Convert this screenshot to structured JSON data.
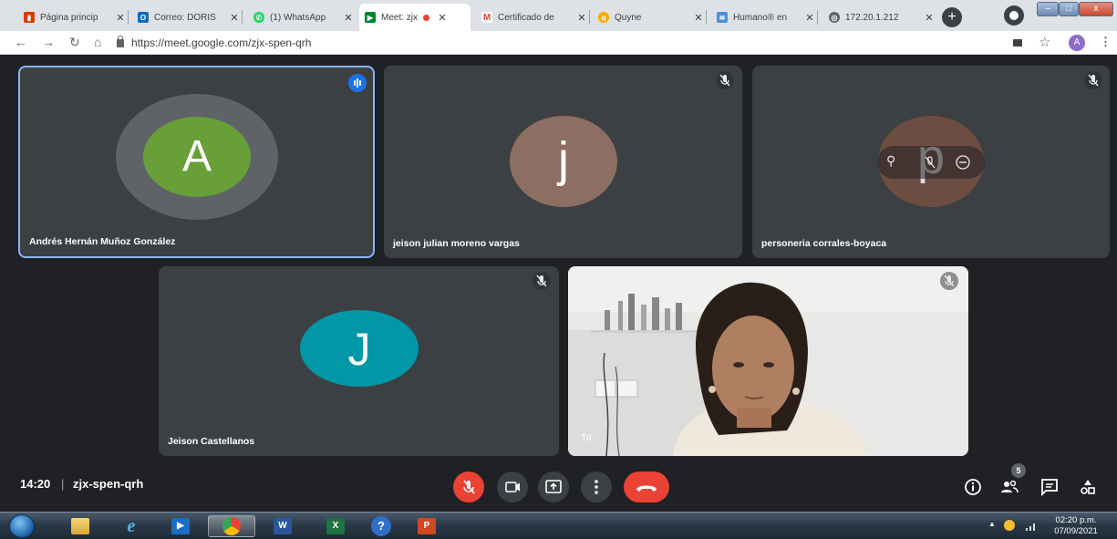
{
  "browser": {
    "tabs": [
      {
        "title": "Página princip",
        "favicon": "office-icon",
        "color": "#d83b01",
        "active": false
      },
      {
        "title": "Correo: DORIS",
        "favicon": "outlook-icon",
        "color": "#0f6cbd",
        "active": false
      },
      {
        "title": "(1) WhatsApp",
        "favicon": "whatsapp-icon",
        "color": "#25d366",
        "active": false
      },
      {
        "title": "Meet: zjx-",
        "favicon": "meet-icon",
        "color": "#00832d",
        "active": true,
        "recording": true
      },
      {
        "title": "Certificado de",
        "favicon": "gmail-icon",
        "color": "#ea4335",
        "active": false
      },
      {
        "title": "Quyne",
        "favicon": "quyne-icon",
        "color": "#f9ab00",
        "active": false
      },
      {
        "title": "Humano® en",
        "favicon": "humano-icon",
        "color": "#4a90d9",
        "active": false
      },
      {
        "title": "172.20.1.212",
        "favicon": "globe-icon",
        "color": "#5f6368",
        "active": false
      }
    ],
    "new_tab_label": "+",
    "url": "https://meet.google.com/zjx-spen-qrh",
    "profile_initial": "A",
    "window_buttons": {
      "minimize": "–",
      "maximize": "□",
      "close": "x"
    }
  },
  "meet": {
    "participants": [
      {
        "name": "Andrés Hernán Muñoz González",
        "initial": "A",
        "avatar_color": "#689f38",
        "speaking": true
      },
      {
        "name": "jeison julian moreno vargas",
        "initial": "j",
        "avatar_color": "#8d6e63",
        "muted": true
      },
      {
        "name": "personeria corrales-boyaca",
        "initial": "p",
        "avatar_color": "#6d4c41",
        "muted": true,
        "hover_controls": [
          "pin-icon",
          "mute-icon",
          "remove-icon"
        ]
      },
      {
        "name": "Jeison Castellanos",
        "initial": "J",
        "avatar_color": "#0097a7",
        "muted": true
      },
      {
        "name": "Tú",
        "is_self": true,
        "muted": true
      }
    ],
    "bottom_bar": {
      "time": "14:20",
      "separator": "|",
      "meeting_code": "zjx-spen-qrh",
      "controls": [
        "mic-off-icon",
        "camera-icon",
        "present-icon",
        "more-options-icon",
        "end-call-icon"
      ],
      "right_icons": [
        "info-icon",
        "people-icon",
        "chat-icon",
        "activities-icon"
      ],
      "people_count": "5"
    }
  },
  "taskbar": {
    "apps": [
      "file-explorer-icon",
      "internet-explorer-icon",
      "media-player-icon",
      "chrome-icon",
      "word-icon",
      "excel-icon",
      "help-icon",
      "powerpoint-icon"
    ],
    "app_letters": {
      "word": "W",
      "excel": "X",
      "help": "?",
      "powerpoint": "P"
    },
    "tray_time": "02:20 p.m.",
    "tray_date": "07/09/2021",
    "tray_arrow": "▲"
  }
}
